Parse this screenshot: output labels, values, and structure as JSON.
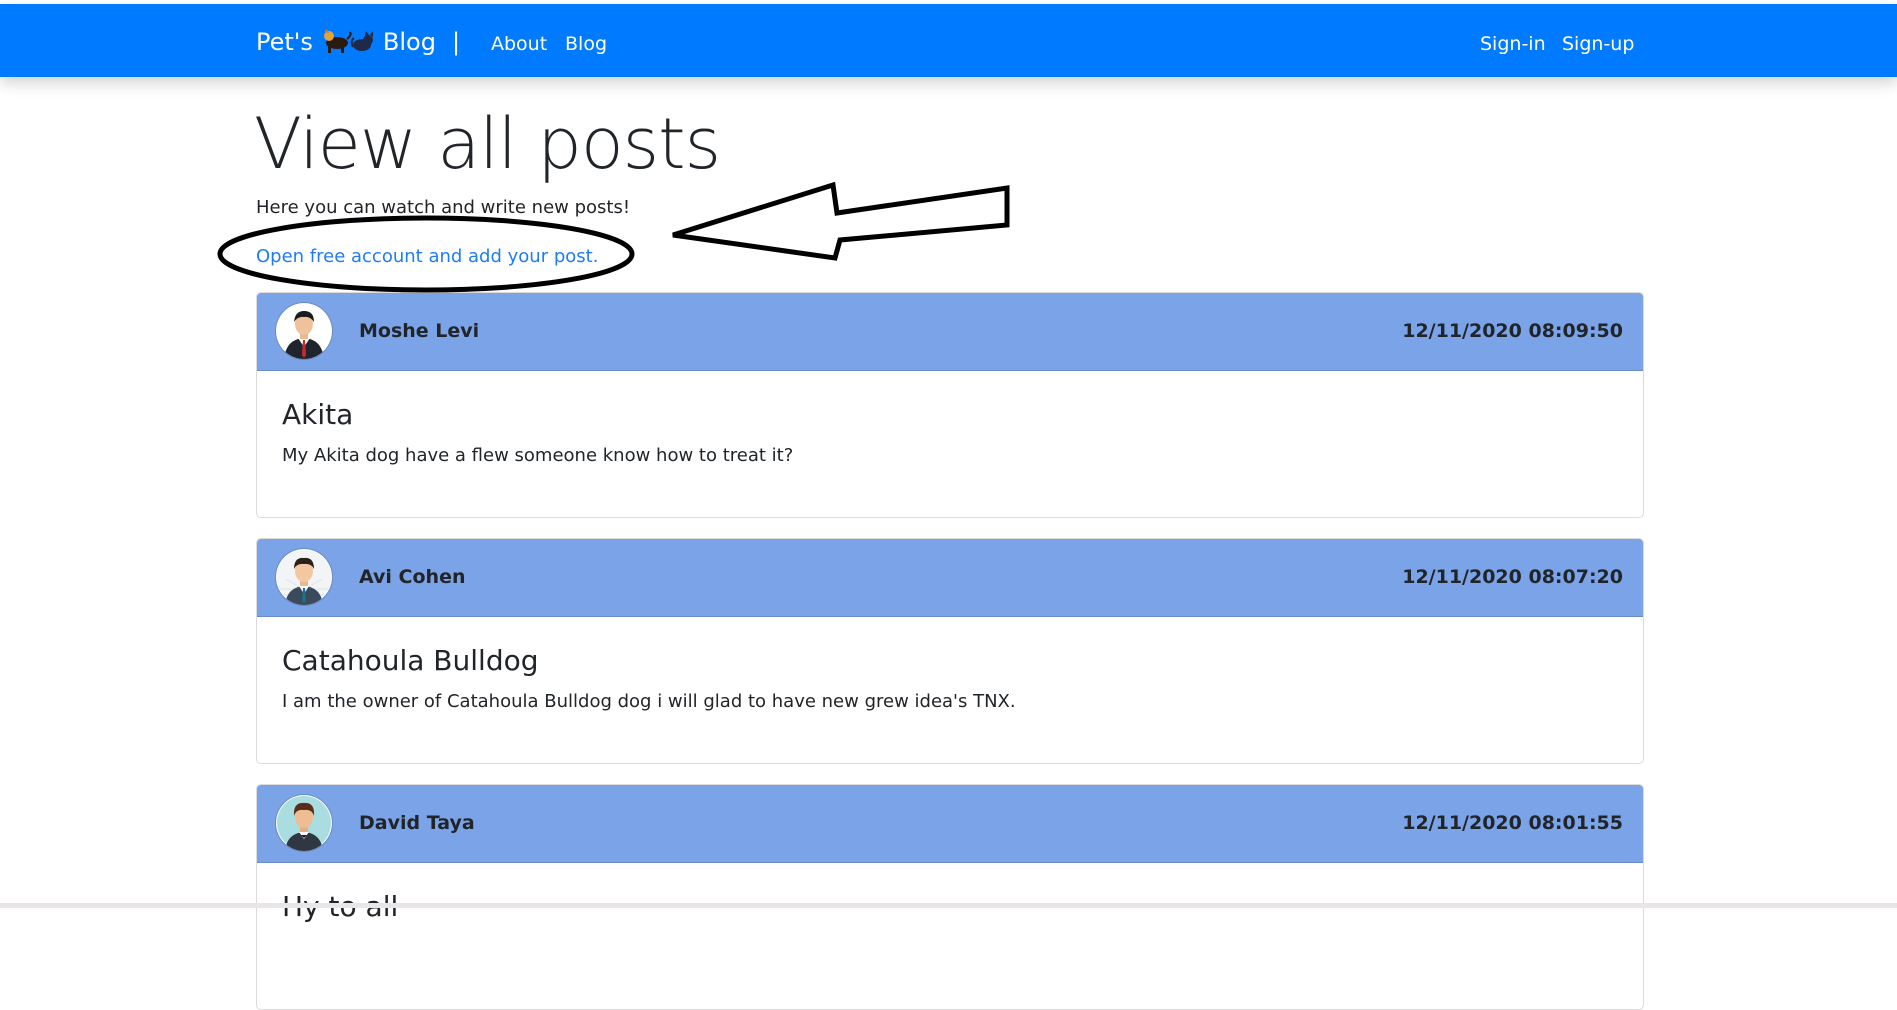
{
  "colors": {
    "navbar": "#007bff",
    "card_header": "#7ba3e8",
    "link": "#1e7df3",
    "text": "#212529"
  },
  "navbar": {
    "brand_prefix": "Pet's",
    "brand_icon": "dog-and-cat-icon",
    "brand_suffix": "Blog",
    "brand_separator": "|",
    "links": [
      {
        "label": "About"
      },
      {
        "label": "Blog"
      }
    ],
    "auth": [
      {
        "label": "Sign-in"
      },
      {
        "label": "Sign-up"
      }
    ]
  },
  "header": {
    "title": "View all posts",
    "lead": "Here you can watch and write new posts!",
    "cta": "Open free account and add your post."
  },
  "posts": [
    {
      "author": "Moshe Levi",
      "timestamp": "12/11/2020 08:09:50",
      "title": "Akita",
      "body": "My Akita dog have a flew someone know how to treat it?",
      "avatar_icon": "businessman-avatar-icon"
    },
    {
      "author": "Avi Cohen",
      "timestamp": "12/11/2020 08:07:20",
      "title": "Catahoula Bulldog",
      "body": "I am the owner of Catahoula Bulldog dog i will glad to have new grew idea's TNX.",
      "avatar_icon": "man-avatar-icon"
    },
    {
      "author": "David Taya",
      "timestamp": "12/11/2020 08:01:55",
      "title": "Hy to all",
      "body": "",
      "avatar_icon": "man-avatar-icon"
    }
  ],
  "annotation": {
    "shapes": [
      "ellipse-highlight",
      "arrow-pointer"
    ]
  }
}
